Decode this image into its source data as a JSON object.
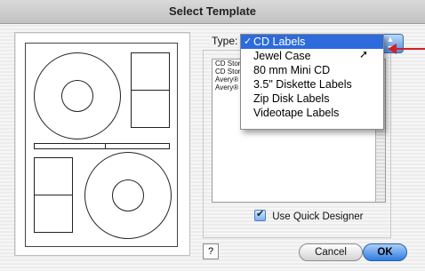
{
  "window": {
    "title": "Select Template"
  },
  "type": {
    "label": "Type:",
    "menu": [
      {
        "label": "CD Labels",
        "selected": true
      },
      {
        "label": "Jewel Case"
      },
      {
        "label": "80 mm Mini CD"
      },
      {
        "label": "3.5\" Diskette Labels"
      },
      {
        "label": "Zip Disk Labels"
      },
      {
        "label": "Videotape Labels"
      }
    ]
  },
  "template_list": [
    "CD Stor",
    "CD Stor",
    "Avery®",
    "Avery®"
  ],
  "quick_designer": {
    "label": "Use Quick Designer",
    "checked": true
  },
  "buttons": {
    "help": "?",
    "cancel": "Cancel",
    "ok": "OK"
  },
  "colors": {
    "selection": "#2d6bdc",
    "annotation_arrow": "#d0202a",
    "ok_button": "#2f7ce0"
  }
}
